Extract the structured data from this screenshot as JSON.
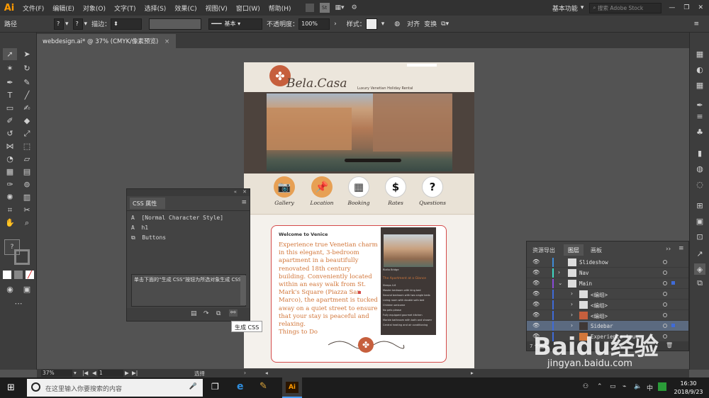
{
  "app": {
    "logo": "Ai"
  },
  "menubar": {
    "items": [
      "文件(F)",
      "编辑(E)",
      "对象(O)",
      "文字(T)",
      "选择(S)",
      "效果(C)",
      "视图(V)",
      "窗口(W)",
      "帮助(H)"
    ],
    "st_badge": "St",
    "workspace": "基本功能",
    "search_placeholder": "搜索 Adobe Stock"
  },
  "controlbar": {
    "selection_label": "路径",
    "stroke_label": "描边：",
    "stroke_style": "基本",
    "opacity_label": "不透明度：",
    "opacity_value": "100%",
    "style_label": "样式：",
    "align_label": "对齐",
    "transform_label": "变换"
  },
  "document_tab": {
    "title": "webdesign.ai* @ 37% (CMYK/像素预览)",
    "close": "×"
  },
  "artboard": {
    "brand": "Bela.Casa",
    "tagline": "Luxury Venetian Holiday Rental",
    "nav": [
      {
        "icon": "camera-icon",
        "label": "Gallery",
        "bg": "#e7a054"
      },
      {
        "icon": "pin-icon",
        "label": "Location",
        "bg": "#e7a054"
      },
      {
        "icon": "calendar-icon",
        "label": "Booking",
        "bg": "#ffffff"
      },
      {
        "icon": "dollar-icon",
        "label": "Rates",
        "bg": "#ffffff"
      },
      {
        "icon": "question-icon",
        "label": "Questions",
        "bg": "#ffffff"
      }
    ],
    "nav_glyphs": [
      "📷",
      "📌",
      "▦",
      "$",
      "?"
    ],
    "welcome": "Welcome to Venice",
    "body": "Experience true Venetian charm in this elegant, 3-bedroom apartment in a beautifully renovated 18th century building. Conveniently located within an easy walk from St. Mark's Square (Piazza San Marco), the apartment is tucked away on a quiet street to ensure that your stay is peaceful and relaxing.",
    "things_to_do": "Things to Do",
    "sidebar": {
      "caption": "Rialto Bridge",
      "heading": "The Apartment at a Glance",
      "items": [
        "Sleeps 4-6",
        "Master bedroom with king bed",
        "Second bedroom with two single beds",
        "Living room with double sofa bed",
        "Children welcome",
        "No pets please",
        "Fully equipped gourmet kitchen",
        "Marble bathroom with bath and shower",
        "Central heating and air conditioning"
      ]
    }
  },
  "css_panel": {
    "title": "CSS 属性",
    "rows": [
      "[Normal Character Style]",
      "h1",
      "Buttons"
    ],
    "row_glyphs": [
      "A",
      "A",
      "⧉"
    ],
    "hint": "单击下面的“生成 CSS”按钮为所选对象生成 CSS",
    "tooltip": "生成 CSS"
  },
  "layers_panel": {
    "tabs": [
      "资源导出",
      "图层",
      "画板"
    ],
    "active_tab": "图层",
    "rows": [
      {
        "name": "Slideshow",
        "color": "#3f8bd8"
      },
      {
        "name": "Nav",
        "color": "#3fd8c4"
      },
      {
        "name": "Main",
        "color": "#8a4ad8",
        "expanded": true
      },
      {
        "name": "<编组>",
        "color": "#3f6bd8"
      },
      {
        "name": "<编组>",
        "color": "#3f6bd8"
      },
      {
        "name": "<编组>",
        "color": "#3f6bd8"
      },
      {
        "name": "Sidebar",
        "color": "#3f6bd8",
        "selected": true
      },
      {
        "name": "Experience tru...",
        "color": "#3f6bd8"
      }
    ],
    "footer": "7 个图层"
  },
  "statusbar": {
    "zoom": "37%",
    "page": "1",
    "tool": "选择"
  },
  "taskbar": {
    "search_placeholder": "在这里输入你要搜索的内容",
    "time": "16:30",
    "date": "2018/9/23"
  },
  "watermark": {
    "text": "Baidu经验",
    "url": "jingyan.baidu.com"
  },
  "colors": {
    "accent_orange": "#ff9a00",
    "body_text": "#d2773b",
    "selection_red": "#d44a4a"
  }
}
